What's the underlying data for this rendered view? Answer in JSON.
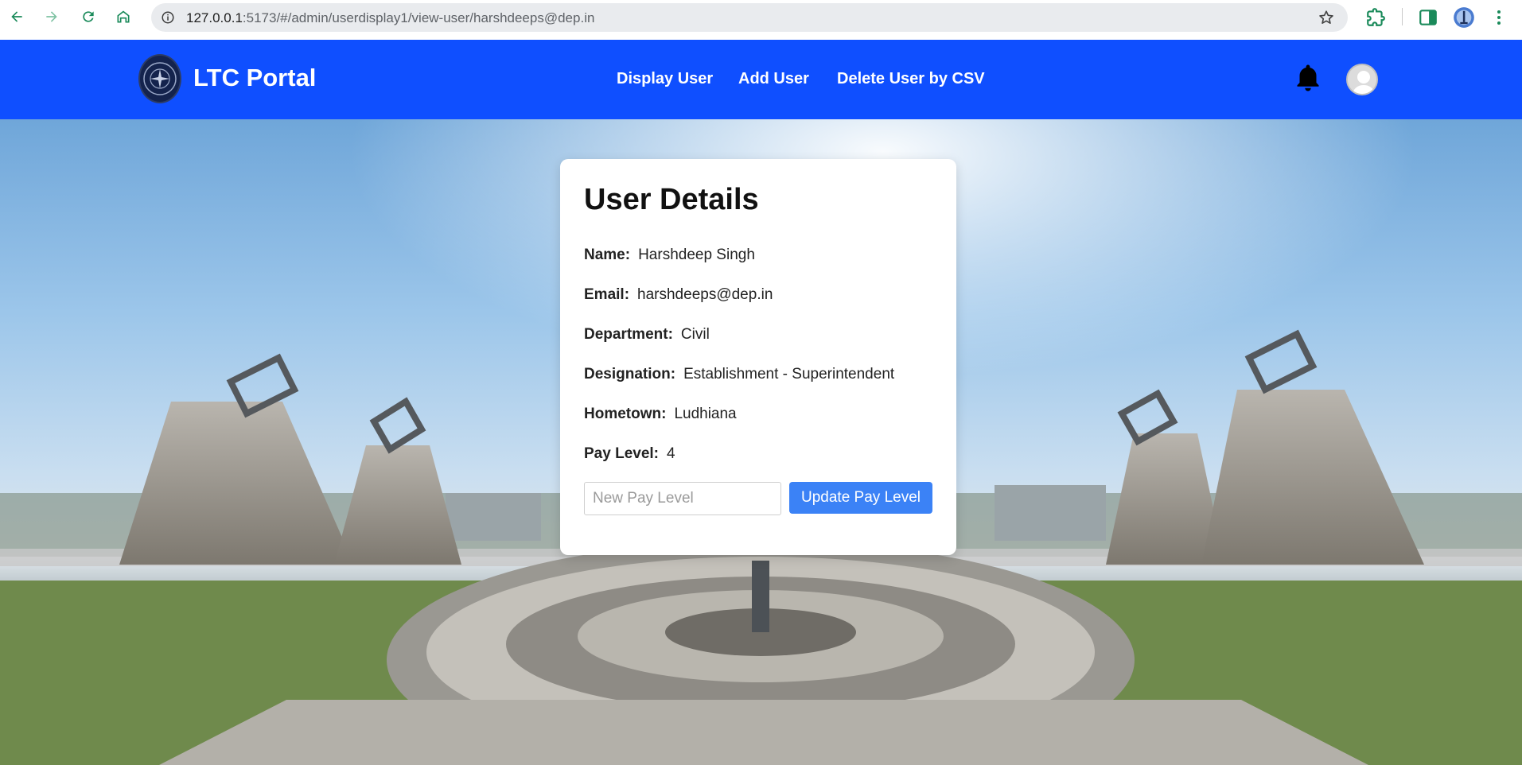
{
  "browser": {
    "url_host": "127.0.0.1",
    "url_path": ":5173/#/admin/userdisplay1/view-user/harshdeeps@dep.in"
  },
  "nav": {
    "brand": "LTC Portal",
    "links": [
      "Display User",
      "Add User",
      "Delete User by CSV"
    ]
  },
  "card": {
    "title": "User Details",
    "fields": [
      {
        "label": "Name:",
        "value": "Harshdeep Singh"
      },
      {
        "label": "Email:",
        "value": "harshdeeps@dep.in"
      },
      {
        "label": "Department:",
        "value": "Civil"
      },
      {
        "label": "Designation:",
        "value": "Establishment - Superintendent"
      },
      {
        "label": "Hometown:",
        "value": "Ludhiana"
      },
      {
        "label": "Pay Level:",
        "value": "4"
      }
    ],
    "input_placeholder": "New Pay Level",
    "button_label": "Update Pay Level"
  },
  "colors": {
    "nav_bg": "#0f4fff",
    "button_bg": "#3b82f6",
    "chrome_icon": "#1a8a5a"
  },
  "icons": [
    "back-icon",
    "forward-icon",
    "reload-icon",
    "home-icon",
    "info-icon",
    "star-icon",
    "extensions-icon",
    "sidebar-icon",
    "profile-icon",
    "menu-dots-icon",
    "bell-icon",
    "avatar-icon"
  ]
}
